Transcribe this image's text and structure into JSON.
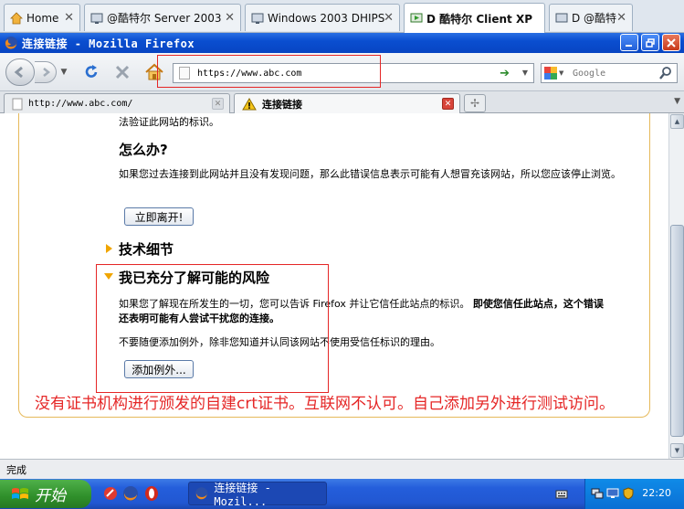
{
  "host_tabs": [
    {
      "label": "Home",
      "icon": "home-icon",
      "active": false
    },
    {
      "label": "@酷特尔 Server 2003",
      "icon": "vm-icon",
      "active": false
    },
    {
      "label": "Windows 2003 DHIPS",
      "icon": "vm-icon",
      "active": false
    },
    {
      "label": "D 酷特尔 Client XP",
      "icon": "vm-play-icon",
      "active": true
    },
    {
      "label": "D @酷特",
      "icon": "vm-icon",
      "active": false
    }
  ],
  "window": {
    "title": "连接链接 - Mozilla Firefox"
  },
  "navbar": {
    "url": "https://www.abc.com",
    "search_placeholder": "Google"
  },
  "browser_tabs": [
    {
      "label": "http://www.abc.com/",
      "active": false
    },
    {
      "label": "连接链接",
      "active": true
    }
  ],
  "content": {
    "top_fragment": "法验证此网站的标识。",
    "what_to_do_heading": "怎么办?",
    "what_to_do_text": "如果您过去连接到此网站并且没有发现问题，那么此错误信息表示可能有人想冒充该网站，所以您应该停止浏览。",
    "get_me_out_button": "立即离开!",
    "tech_details_heading": "技术细节",
    "understand_heading": "我已充分了解可能的风险",
    "understand_text_normal": "如果您了解现在所发生的一切，您可以告诉 Firefox 并让它信任此站点的标识。",
    "understand_text_bold": "即使您信任此站点，这个错误还表明可能有人尝试干扰您的连接。",
    "warning_text": "不要随便添加例外，除非您知道并认同该网站不使用受信任标识的理由。",
    "add_exception_button": "添加例外...",
    "annotation": "没有证书机构进行颁发的自建crt证书。互联网不认可。自己添加另外进行测试访问。"
  },
  "status": {
    "text": "完成"
  },
  "taskbar": {
    "start_label": "开始",
    "task_label": "连接链接 - Mozil...",
    "clock": "22:20"
  },
  "colors": {
    "annotation": "#e52626",
    "box_border": "#e6b95a",
    "titlebar": "#0a4ed0"
  }
}
